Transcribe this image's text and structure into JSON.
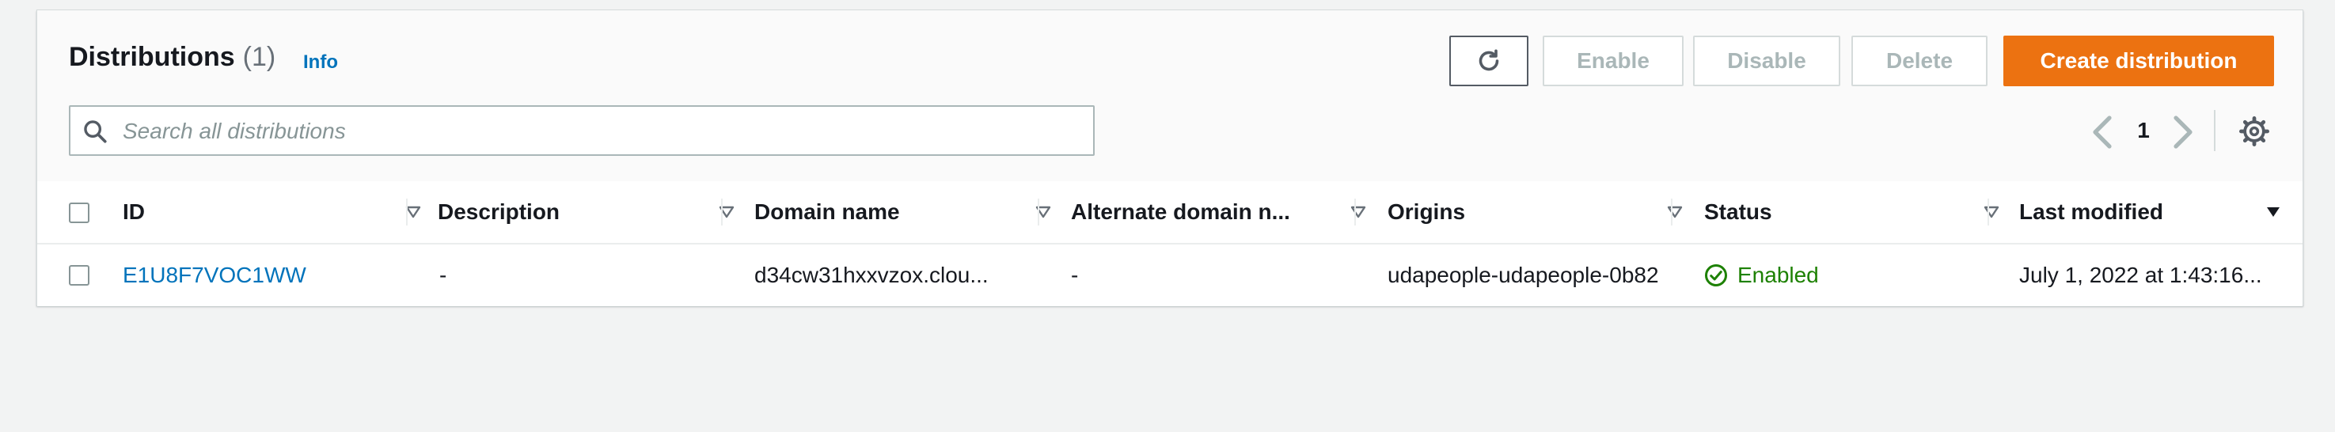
{
  "header": {
    "title": "Distributions",
    "count": "(1)",
    "info_link": "Info"
  },
  "toolbar": {
    "refresh_icon": "refresh-icon",
    "enable_label": "Enable",
    "disable_label": "Disable",
    "delete_label": "Delete",
    "create_label": "Create distribution"
  },
  "search": {
    "placeholder": "Search all distributions",
    "value": "",
    "icon": "search-icon"
  },
  "pagination": {
    "current_page": "1"
  },
  "table": {
    "columns": [
      {
        "label": "ID"
      },
      {
        "label": "Description"
      },
      {
        "label": "Domain name"
      },
      {
        "label": "Alternate domain n..."
      },
      {
        "label": "Origins"
      },
      {
        "label": "Status"
      },
      {
        "label": "Last modified"
      }
    ],
    "rows": [
      {
        "id": "E1U8F7VOC1WW",
        "description": "-",
        "domain_name": "d34cw31hxxvzox.clou...",
        "alternate_domain": "-",
        "origins": "udapeople-udapeople-0b82",
        "status": "Enabled",
        "last_modified": "July 1, 2022 at 1:43:16..."
      }
    ]
  },
  "colors": {
    "accent": "#ec7211",
    "link": "#0073bb",
    "status_enabled": "#1d8102"
  }
}
